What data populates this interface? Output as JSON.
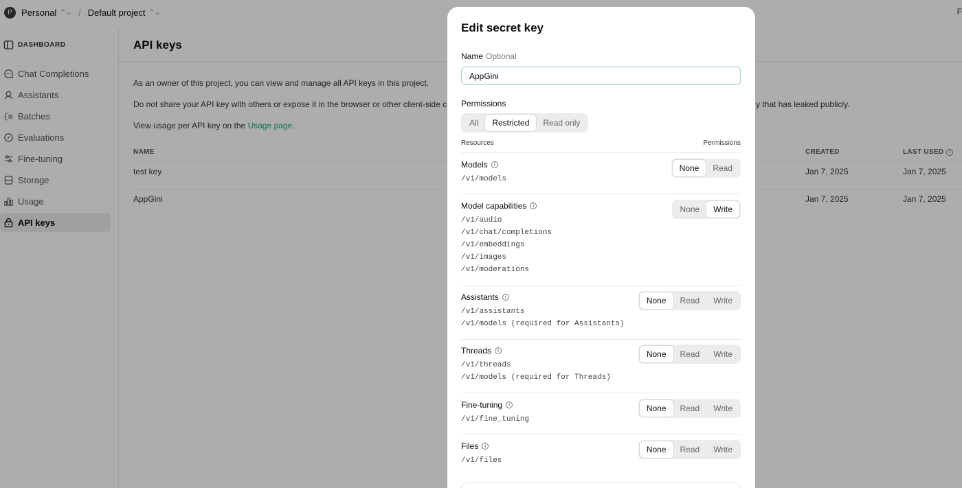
{
  "topbar": {
    "avatar_letter": "P",
    "org": "Personal",
    "project": "Default project",
    "separator": "/",
    "right_text": "F"
  },
  "sidebar": {
    "items": [
      {
        "label": "DASHBOARD",
        "icon": "dashboard-icon"
      },
      {
        "label": "Chat Completions",
        "icon": "chat-icon"
      },
      {
        "label": "Assistants",
        "icon": "assistant-icon"
      },
      {
        "label": "Batches",
        "icon": "batches-icon"
      },
      {
        "label": "Evaluations",
        "icon": "evaluations-icon"
      },
      {
        "label": "Fine-tuning",
        "icon": "fine-tuning-icon"
      },
      {
        "label": "Storage",
        "icon": "storage-icon"
      },
      {
        "label": "Usage",
        "icon": "usage-icon"
      },
      {
        "label": "API keys",
        "icon": "lock-icon"
      }
    ]
  },
  "main": {
    "title": "API keys",
    "para1": "As an owner of this project, you can view and manage all API keys in this project.",
    "para2_start": "Do not share your API key with others or expose it in the browser or other client-side co",
    "para2_end": "y that has leaked publicly.",
    "para3_prefix": "View usage per API key on the ",
    "para3_link": "Usage page",
    "para3_suffix": ".",
    "columns": {
      "name": "NAME",
      "created": "CREATED",
      "last_used": "LAST USED"
    },
    "rows": [
      {
        "name": "test key",
        "created": "Jan 7, 2025",
        "last_used": "Jan 7, 2025"
      },
      {
        "name": "AppGini",
        "created": "Jan 7, 2025",
        "last_used": "Jan 7, 2025"
      }
    ]
  },
  "modal": {
    "title": "Edit secret key",
    "name_label": "Name",
    "name_optional": "Optional",
    "name_value": "AppGini",
    "permissions_label": "Permissions",
    "permission_tabs": [
      "All",
      "Restricted",
      "Read only"
    ],
    "permission_selected": "Restricted",
    "resources_header": "Resources",
    "permissions_header": "Permissions",
    "resources": [
      {
        "title": "Models",
        "paths": [
          "/v1/models"
        ],
        "options": [
          "None",
          "Read"
        ],
        "selected": "None"
      },
      {
        "title": "Model capabilities",
        "paths": [
          "/v1/audio",
          "/v1/chat/completions",
          "/v1/embeddings",
          "/v1/images",
          "/v1/moderations"
        ],
        "options": [
          "None",
          "Write"
        ],
        "selected": "Write"
      },
      {
        "title": "Assistants",
        "paths": [
          "/v1/assistants",
          "/v1/models (required for Assistants)"
        ],
        "options": [
          "None",
          "Read",
          "Write"
        ],
        "selected": "None"
      },
      {
        "title": "Threads",
        "paths": [
          "/v1/threads",
          "/v1/models (required for Threads)"
        ],
        "options": [
          "None",
          "Read",
          "Write"
        ],
        "selected": "None"
      },
      {
        "title": "Fine-tuning",
        "paths": [
          "/v1/fine_tuning"
        ],
        "options": [
          "None",
          "Read",
          "Write"
        ],
        "selected": "None"
      },
      {
        "title": "Files",
        "paths": [
          "/v1/files"
        ],
        "options": [
          "None",
          "Read",
          "Write"
        ],
        "selected": "None"
      }
    ]
  }
}
